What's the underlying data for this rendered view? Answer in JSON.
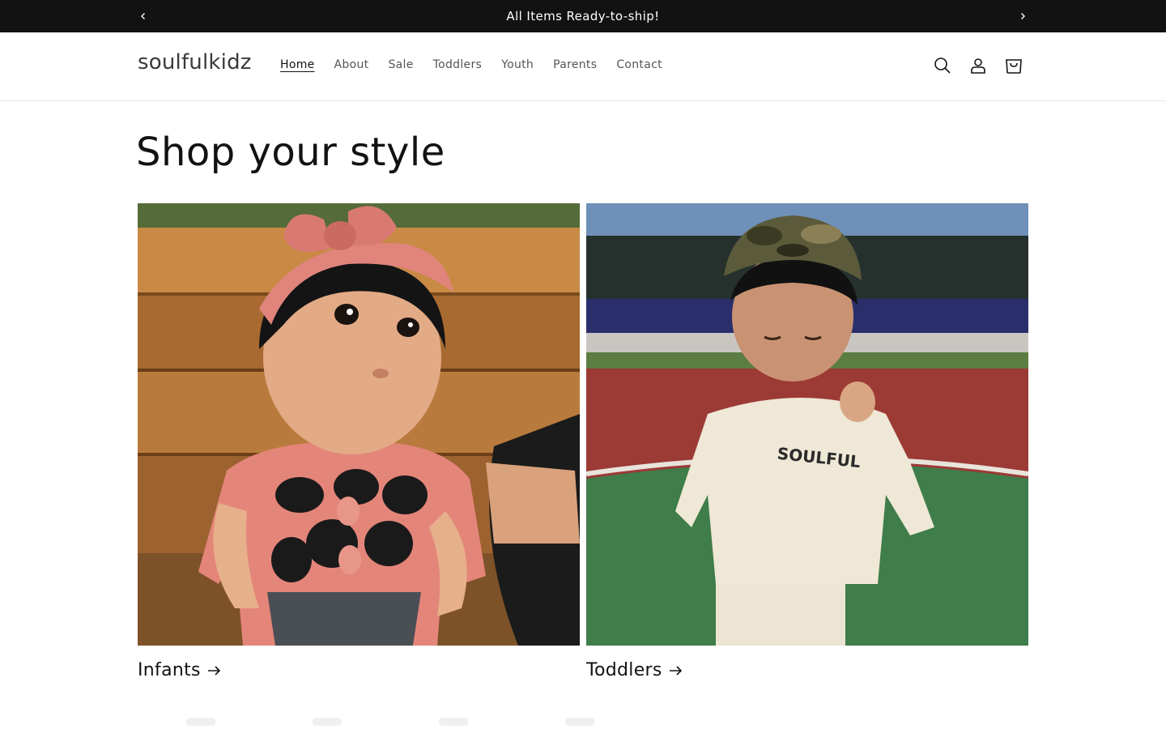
{
  "announcement": {
    "text": "All Items Ready-to-ship!"
  },
  "header": {
    "logo": "soulfulkidz",
    "nav": [
      {
        "label": "Home",
        "active": true
      },
      {
        "label": "About"
      },
      {
        "label": "Sale"
      },
      {
        "label": "Toddlers"
      },
      {
        "label": "Youth"
      },
      {
        "label": "Parents"
      },
      {
        "label": "Contact"
      }
    ],
    "icons": [
      "search-icon",
      "account-icon",
      "cart-icon"
    ]
  },
  "main": {
    "title": "Shop your style",
    "collections": [
      {
        "label": "Infants",
        "image": "baby-in-pink-headband-photo"
      },
      {
        "label": "Toddlers",
        "image": "toddler-in-cream-soulful-sweatshirt-photo",
        "shirt_text": "SOULFUL"
      }
    ]
  },
  "colors": {
    "announcement_bg": "#121212",
    "text": "#121212",
    "nav_text": "#555555"
  }
}
